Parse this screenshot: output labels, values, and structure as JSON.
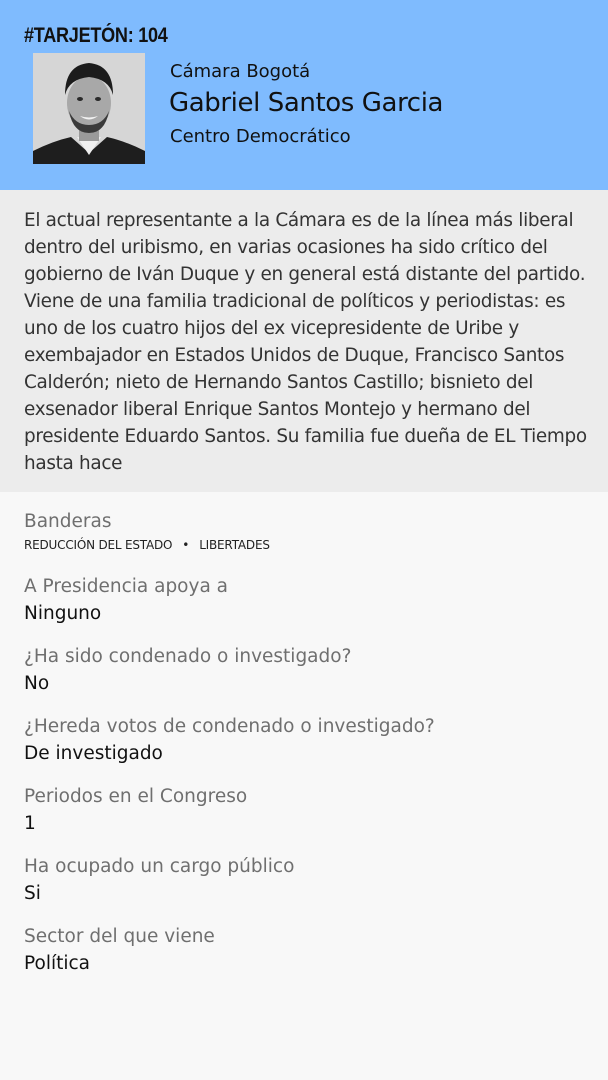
{
  "header": {
    "tag": "#TARJETÓN: 104",
    "chamber": "Cámara Bogotá",
    "name": "Gabriel Santos Garcia",
    "party": "Centro Democrático",
    "background_color": "#7fbbfe"
  },
  "bio": {
    "text": "El actual representante a la Cámara es de la línea más liberal dentro del uribismo, en varias ocasiones ha sido crítico del gobierno de Iván Duque y en general está distante del partido. Viene de una familia tradicional de políticos y periodistas: es uno de los cuatro hijos del ex vicepresidente de Uribe y exembajador en Estados Unidos de Duque, Francisco Santos Calderón; nieto de Hernando Santos Castillo; bisnieto del exsenador liberal Enrique Santos Montejo y hermano del presidente Eduardo Santos. Su familia fue dueña de EL Tiempo hasta hace"
  },
  "details": {
    "banderas": {
      "label": "Banderas",
      "items": [
        "REDUCCIÓN DEL ESTADO",
        "LIBERTADES"
      ],
      "separator": "•"
    },
    "presidencia": {
      "label": "A Presidencia apoya a",
      "value": "Ninguno"
    },
    "condenado": {
      "label": "¿Ha sido condenado o investigado?",
      "value": "No"
    },
    "hereda": {
      "label": "¿Hereda votos de condenado o investigado?",
      "value": "De investigado"
    },
    "periodos": {
      "label": "Periodos en el Congreso",
      "value": "1"
    },
    "cargo": {
      "label": "Ha ocupado un cargo público",
      "value": "Si"
    },
    "sector": {
      "label": "Sector del que viene",
      "value": "Política"
    }
  }
}
